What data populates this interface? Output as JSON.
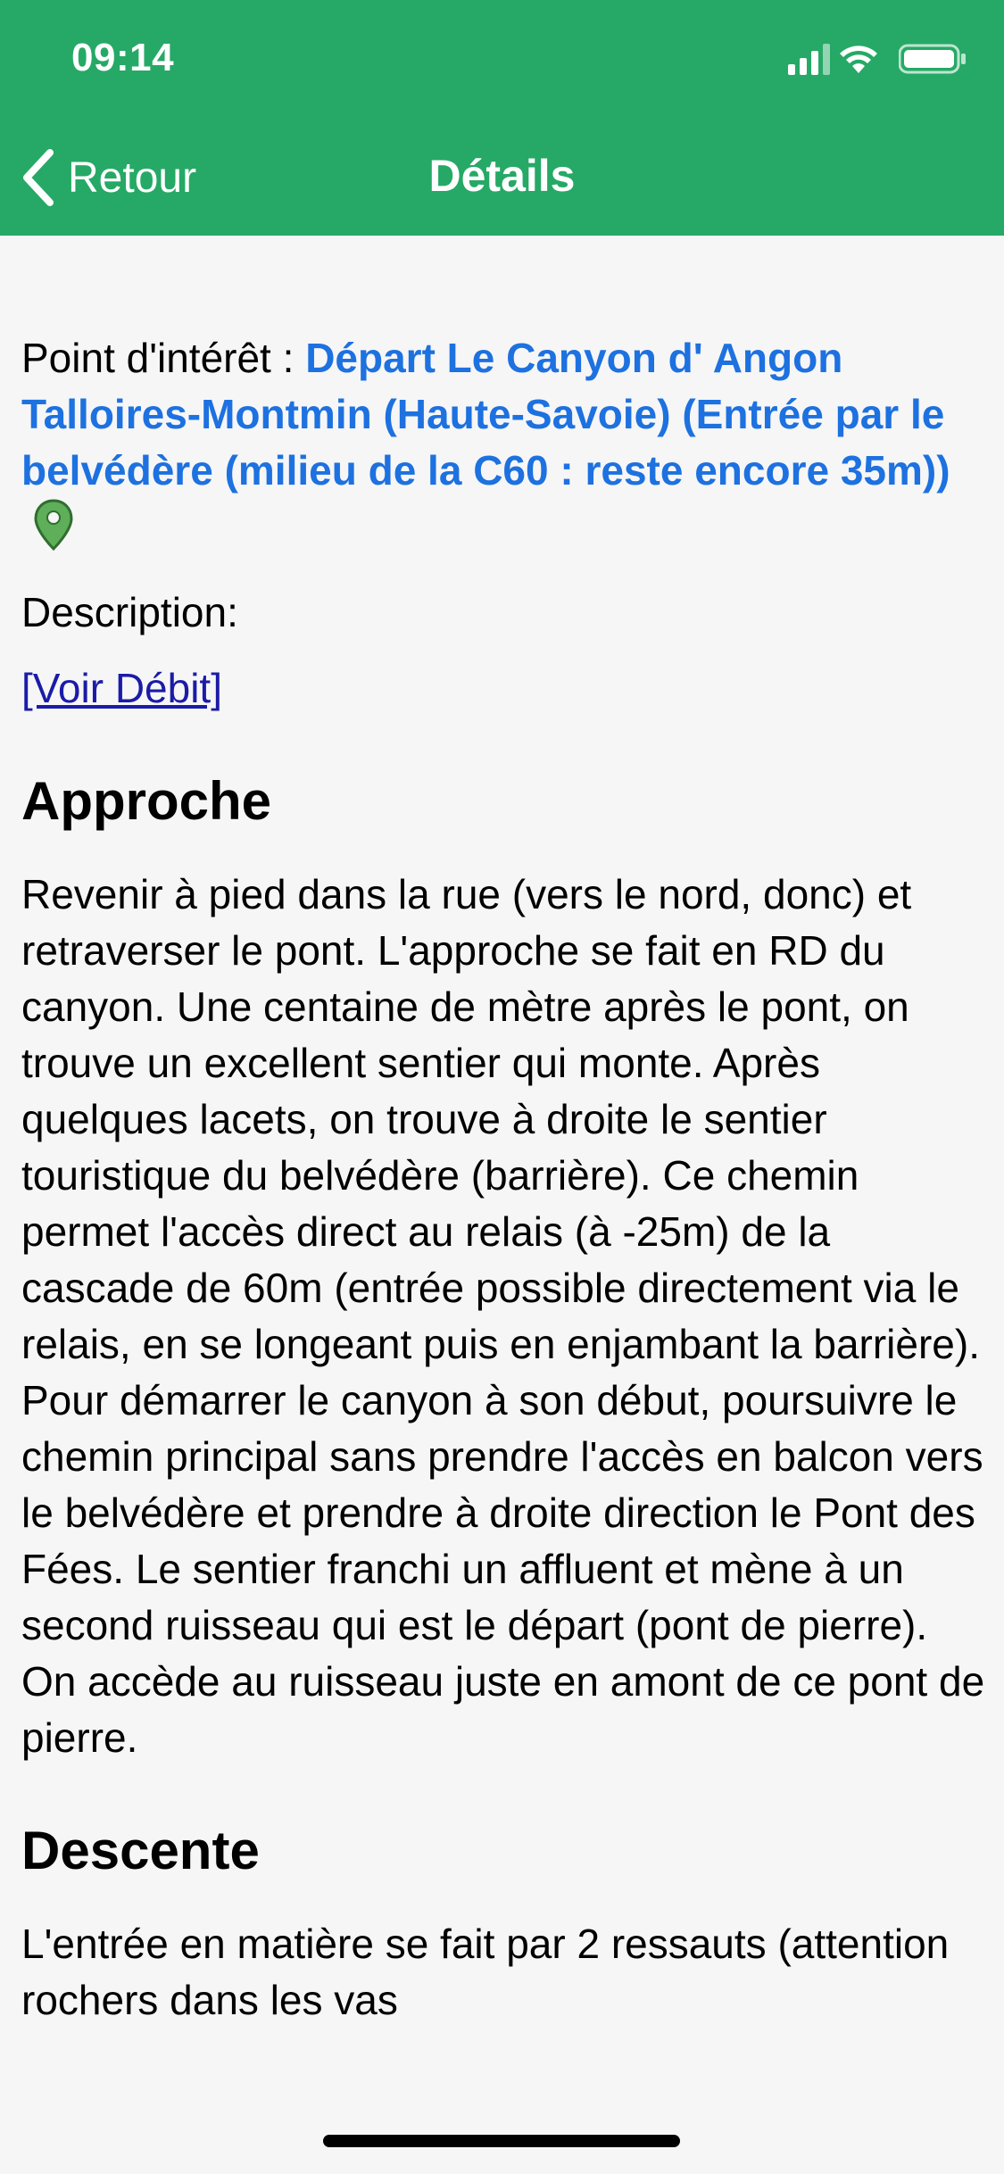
{
  "status_bar": {
    "time": "09:14"
  },
  "nav": {
    "back_label": "Retour",
    "title": "Détails"
  },
  "poi": {
    "label": "Point d'intérêt : ",
    "link_text": "Départ Le Canyon d' Angon Talloires-Montmin (Haute-Savoie) (Entrée par le belvédère (milieu de la C60 : reste encore 35m))",
    "pin_icon": "map-pin-icon"
  },
  "description_label": "Description:",
  "voir_debit_link": "[Voir Débit]",
  "sections": [
    {
      "heading": "Approche",
      "text": "Revenir à pied dans la rue (vers le nord, donc) et retraverser le pont. L'approche se fait en RD du canyon. Une centaine de mètre après le pont, on trouve un excellent sentier qui monte. Après quelques lacets, on trouve à droite le sentier touristique du belvédère (barrière). Ce chemin permet l'accès direct au relais (à -25m) de la cascade de 60m (entrée possible directement via le relais, en se longeant puis en enjambant la barrière).\nPour démarrer le canyon à son début, poursuivre le chemin principal sans prendre l'accès en balcon vers le belvédère et prendre à droite direction le Pont des Fées. Le sentier franchi un affluent et mène à un second ruisseau qui est le départ (pont de pierre). On accède au ruisseau juste en amont de ce pont de pierre."
    },
    {
      "heading": "Descente",
      "text": "L'entrée en matière se fait par 2 ressauts (attention rochers dans les vas"
    }
  ],
  "colors": {
    "header_bg": "#26a966",
    "link_blue": "#1d71e0",
    "pin_green": "#4a9a4a"
  }
}
